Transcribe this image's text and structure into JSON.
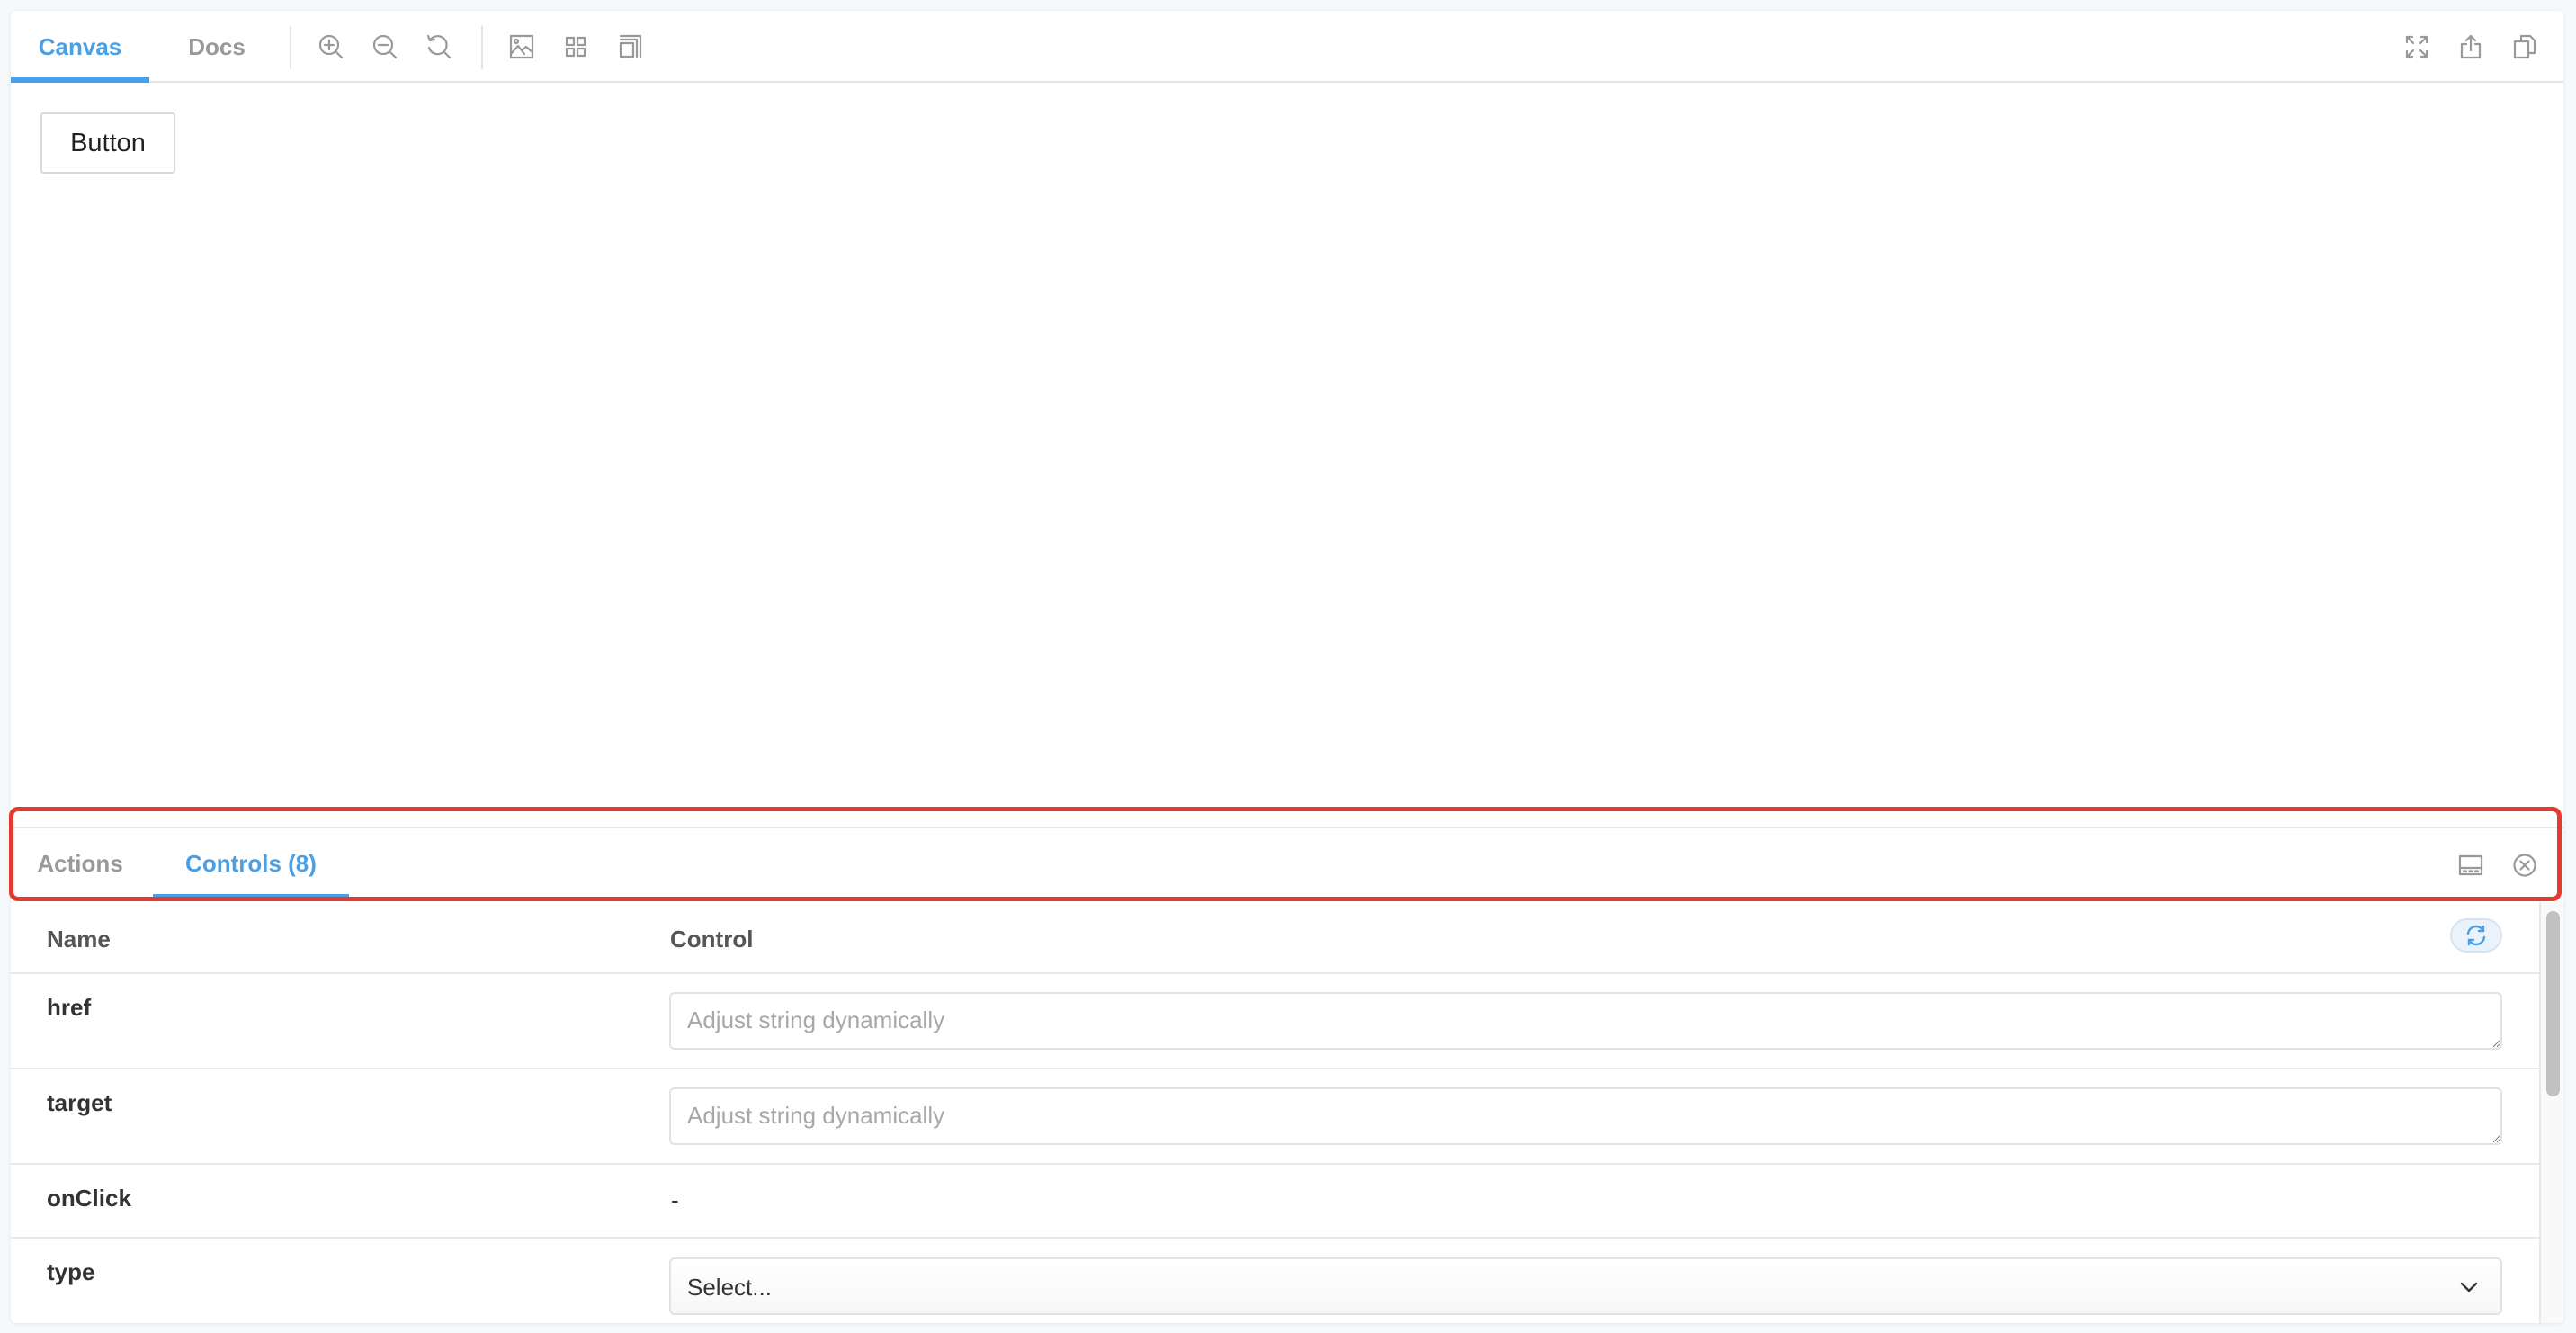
{
  "toolbar": {
    "tabs": [
      {
        "label": "Canvas",
        "active": true
      },
      {
        "label": "Docs",
        "active": false
      }
    ],
    "tools": [
      "zoom-in-icon",
      "zoom-out-icon",
      "reset-zoom-icon",
      "background-icon",
      "grid-icon",
      "outline-icon"
    ],
    "right_tools": [
      "fullscreen-icon",
      "share-icon",
      "copy-icon"
    ]
  },
  "preview": {
    "button_label": "Button"
  },
  "addons": {
    "tabs": [
      {
        "label": "Actions",
        "active": false
      },
      {
        "label": "Controls (8)",
        "active": true
      }
    ],
    "icons": [
      "panel-orientation-icon",
      "close-icon"
    ],
    "table": {
      "headers": {
        "name": "Name",
        "control": "Control"
      },
      "reset_icon": "reset-icon",
      "rows": [
        {
          "name": "href",
          "control": "textarea",
          "placeholder": "Adjust string dynamically",
          "value": ""
        },
        {
          "name": "target",
          "control": "textarea",
          "placeholder": "Adjust string dynamically",
          "value": ""
        },
        {
          "name": "onClick",
          "control": "none",
          "value": "-"
        },
        {
          "name": "type",
          "control": "select",
          "value": "Select..."
        }
      ]
    }
  },
  "colors": {
    "accent": "#4a9fe5",
    "annotation": "#e53a2f",
    "background": "#f6f9fc"
  }
}
